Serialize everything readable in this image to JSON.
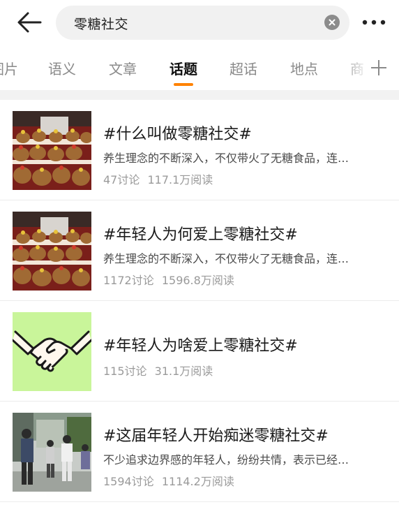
{
  "search": {
    "query": "零糖社交"
  },
  "icons": {
    "back": "arrow-left-icon",
    "clear": "clear-x-icon",
    "more": "more-dots-icon",
    "add": "plus-icon"
  },
  "tabs": [
    {
      "label": "图片"
    },
    {
      "label": "语义"
    },
    {
      "label": "文章"
    },
    {
      "label": "话题"
    },
    {
      "label": "超话"
    },
    {
      "label": "地点"
    },
    {
      "label": "商"
    }
  ],
  "active_tab": "话题",
  "colors": {
    "accent": "#ff8200",
    "handshake_bg": "#c9f59a"
  },
  "results": [
    {
      "title": "#什么叫做零糖社交#",
      "desc": "养生理念的不断深入，不仅带火了无糖食品，连…",
      "discussions": "47讨论",
      "reads": "117.1万阅读",
      "thumb": "capybara-plush-photo"
    },
    {
      "title": "#年轻人为何爱上零糖社交#",
      "desc": "养生理念的不断深入，不仅带火了无糖食品，连…",
      "discussions": "1172讨论",
      "reads": "1596.8万阅读",
      "thumb": "capybara-plush-photo"
    },
    {
      "title": "#年轻人为啥爱上零糖社交#",
      "desc": "",
      "discussions": "115讨论",
      "reads": "31.1万阅读",
      "thumb": "handshake-illustration"
    },
    {
      "title": "#这届年轻人开始痴迷零糖社交#",
      "desc": "不少追求边界感的年轻人，纷纷共情，表示已经…",
      "discussions": "1594讨论",
      "reads": "1114.2万阅读",
      "thumb": "people-walking-photo"
    }
  ]
}
